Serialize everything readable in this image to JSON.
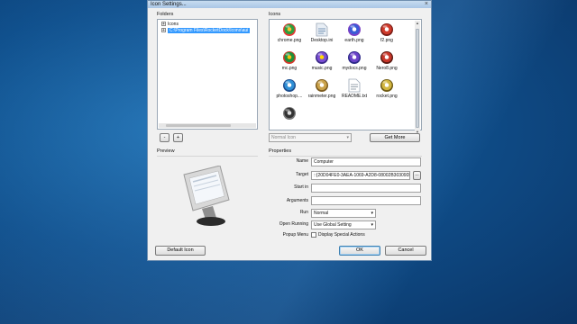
{
  "window": {
    "title": "Icon Settings...",
    "close_glyph": "×"
  },
  "folders": {
    "label": "Folders",
    "tree": [
      {
        "expander": "+",
        "label": "Icons",
        "selected": false
      },
      {
        "expander": "+",
        "label": "C:\\Program Files\\RocketDock\\Icons\\aui",
        "selected": true
      }
    ],
    "minus_label": "-",
    "plus_label": "+"
  },
  "icons": {
    "label": "Icons",
    "items": [
      {
        "name": "chrome.png",
        "icon": "chrome-icon"
      },
      {
        "name": "Desktop.ini",
        "icon": "ini-file-icon"
      },
      {
        "name": "earth.png",
        "icon": "earth-icon"
      },
      {
        "name": "f2.png",
        "icon": "f2-icon"
      },
      {
        "name": "mc.png",
        "icon": "mc-icon"
      },
      {
        "name": "music.png",
        "icon": "music-icon"
      },
      {
        "name": "mydocs.png",
        "icon": "mydocs-icon"
      },
      {
        "name": "Nero8.png",
        "icon": "nero-icon"
      },
      {
        "name": "photoshop....",
        "icon": "photoshop-icon"
      },
      {
        "name": "rainmeter.png",
        "icon": "rainmeter-icon"
      },
      {
        "name": "README.txt",
        "icon": "text-file-icon"
      },
      {
        "name": "rocket.png",
        "icon": "rocket-icon"
      },
      {
        "name": "",
        "icon": "unnamed-icon"
      }
    ],
    "filter_value": "Normal Icon",
    "get_more_label": "Get More"
  },
  "preview": {
    "label": "Preview"
  },
  "properties": {
    "label": "Properties",
    "name_label": "Name",
    "name_value": "Computer",
    "target_label": "Target",
    "target_value": "::{20D04FE0-3AEA-1069-A2D8-08002B30309D}",
    "browse_label": "...",
    "start_in_label": "Start in",
    "start_in_value": "",
    "arguments_label": "Arguments",
    "arguments_value": "",
    "run_label": "Run",
    "run_value": "Normal",
    "open_running_label": "Open Running",
    "open_running_value": "Use Global Setting",
    "popup_menu_label": "Popup Menu",
    "display_special_label": "Display Special Actions"
  },
  "footer": {
    "default_icon_label": "Default Icon",
    "ok_label": "OK",
    "cancel_label": "Cancel"
  },
  "colors": {
    "selection": "#3399ff",
    "desktop": "#0f4f8c"
  }
}
